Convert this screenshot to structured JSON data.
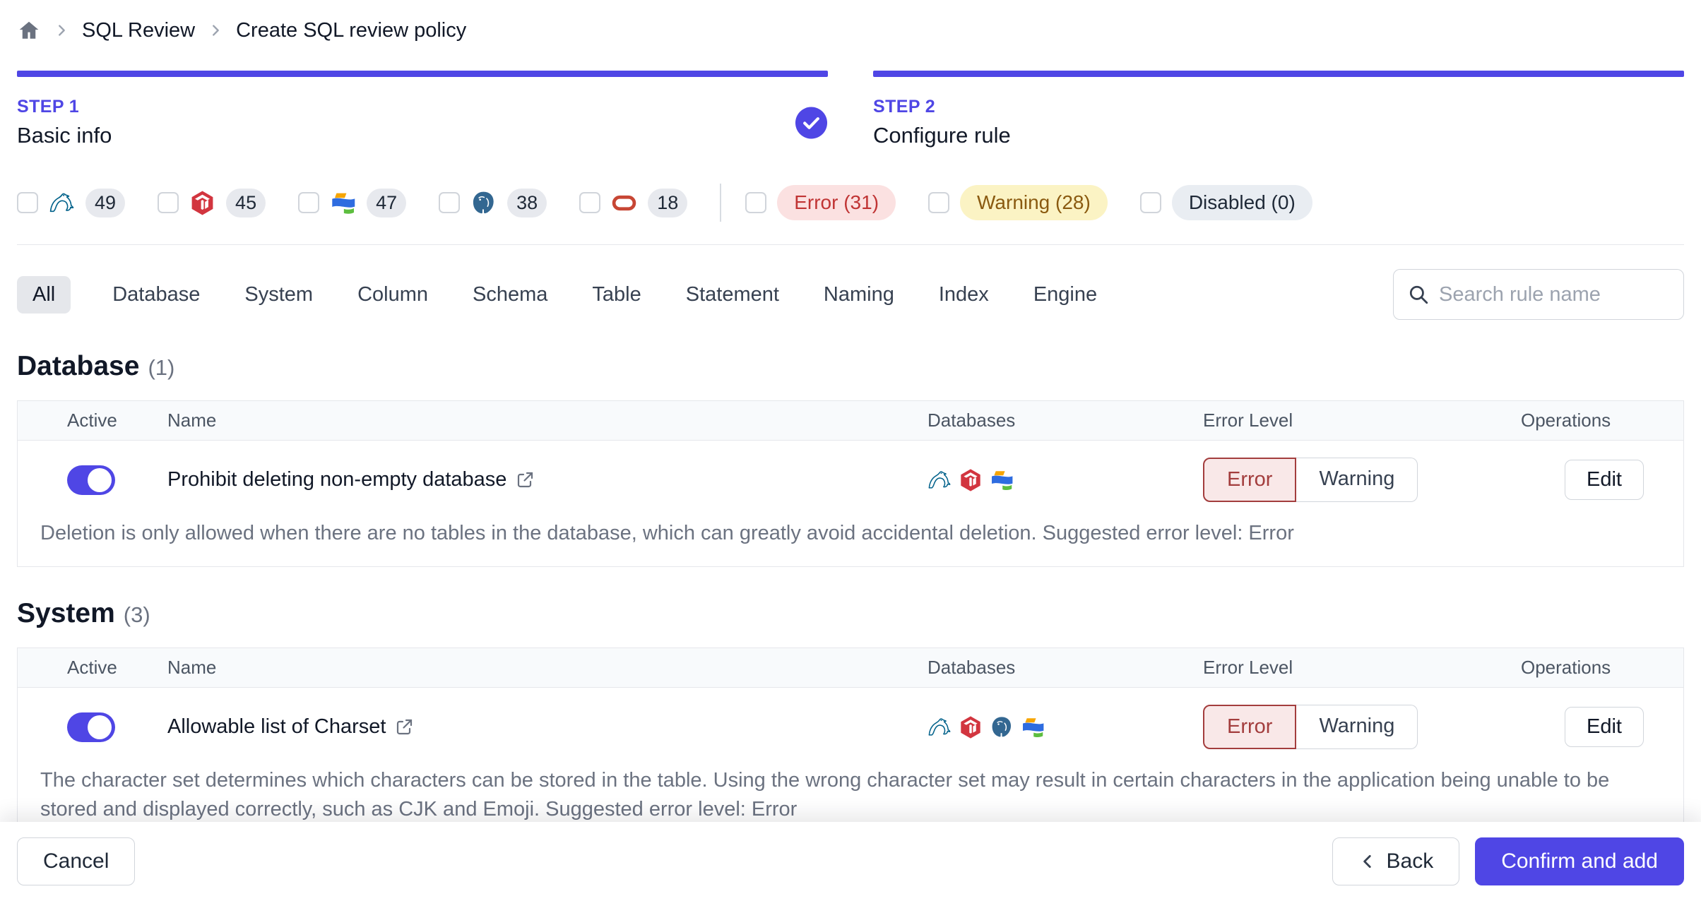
{
  "colors": {
    "accent": "#4f46e5",
    "error_border": "#a33d3d",
    "error_bg": "#f9e8e8",
    "warning_pill_bg": "#fbf3c4",
    "warning_pill_text": "#8a5a10",
    "error_pill_bg": "#fbe1e1",
    "error_pill_text": "#c03434",
    "disabled_pill_bg": "#e9edf2"
  },
  "breadcrumb": {
    "items": [
      "SQL Review",
      "Create SQL review policy"
    ]
  },
  "steps": [
    {
      "label": "STEP 1",
      "title": "Basic info",
      "completed": true
    },
    {
      "label": "STEP 2",
      "title": "Configure rule",
      "completed": false
    }
  ],
  "filters": {
    "engines": [
      {
        "name": "MySQL",
        "count": "49"
      },
      {
        "name": "TiDB",
        "count": "45"
      },
      {
        "name": "OceanBase",
        "count": "47"
      },
      {
        "name": "PostgreSQL",
        "count": "38"
      },
      {
        "name": "Oracle",
        "count": "18"
      }
    ],
    "levels": [
      {
        "label": "Error (31)"
      },
      {
        "label": "Warning (28)"
      },
      {
        "label": "Disabled (0)"
      }
    ]
  },
  "tabs": [
    "All",
    "Database",
    "System",
    "Column",
    "Schema",
    "Table",
    "Statement",
    "Naming",
    "Index",
    "Engine"
  ],
  "active_tab": "All",
  "search": {
    "placeholder": "Search rule name"
  },
  "table_columns": {
    "active": "Active",
    "name": "Name",
    "databases": "Databases",
    "error_level": "Error Level",
    "operations": "Operations"
  },
  "level_options": {
    "error": "Error",
    "warning": "Warning"
  },
  "labels": {
    "edit": "Edit"
  },
  "sections": [
    {
      "title": "Database",
      "count": "(1)",
      "rows": [
        {
          "name": "Prohibit deleting non-empty database",
          "active": true,
          "engines": [
            "MySQL",
            "TiDB",
            "OceanBase"
          ],
          "selected_level": "Error",
          "description": "Deletion is only allowed when there are no tables in the database, which can greatly avoid accidental deletion. Suggested error level: Error"
        }
      ]
    },
    {
      "title": "System",
      "count": "(3)",
      "rows": [
        {
          "name": "Allowable list of Charset",
          "active": true,
          "engines": [
            "MySQL",
            "TiDB",
            "PostgreSQL",
            "OceanBase"
          ],
          "selected_level": "Error",
          "description": "The character set determines which characters can be stored in the table. Using the wrong character set may result in certain characters in the application being unable to be stored and displayed correctly, such as CJK and Emoji. Suggested error level: Error"
        }
      ]
    }
  ],
  "footer": {
    "cancel": "Cancel",
    "back": "Back",
    "confirm": "Confirm and add"
  }
}
